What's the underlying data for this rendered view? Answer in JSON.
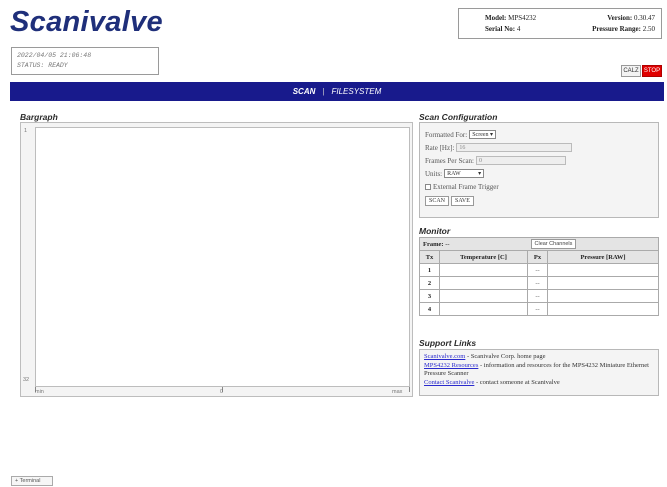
{
  "header": {
    "logo": "Scanivalve",
    "datetime": "2022/04/05 21:06:48",
    "status": "STATUS: READY",
    "model_label": "Model:",
    "model_value": "MPS4232",
    "serial_label": "Serial No:",
    "serial_value": "4",
    "version_label": "Version:",
    "version_value": "0.30.47",
    "range_label": "Pressure Range:",
    "range_value": "2.50",
    "calz_label": "CALZ",
    "stop_label": "STOP"
  },
  "nav": {
    "scan": "SCAN",
    "separator": "|",
    "filesystem": "FILESYSTEM"
  },
  "bargraph": {
    "title": "Bargraph",
    "top_index": "1",
    "bottom_index": "32",
    "x_min": "min",
    "x_mid": "0",
    "x_max": "max"
  },
  "scan_config": {
    "title": "Scan Configuration",
    "formatted_for_label": "Formatted For:",
    "formatted_for_value": "Screen",
    "rate_label": "Rate [Hz]:",
    "rate_value": "16",
    "frames_label": "Frames Per Scan:",
    "frames_value": "0",
    "units_label": "Units:",
    "units_value": "RAW",
    "ext_trigger_label": "External Frame Trigger",
    "scan_button": "SCAN",
    "save_button": "SAVE"
  },
  "monitor": {
    "title": "Monitor",
    "frame_label": "Frame:",
    "frame_value": "--",
    "clear_button": "Clear Channels",
    "headers": [
      "Tx",
      "Temperature [C]",
      "Px",
      "Pressure [RAW]"
    ],
    "rows": [
      {
        "tx": "1",
        "temp": "",
        "px": "--",
        "pressure": ""
      },
      {
        "tx": "2",
        "temp": "",
        "px": "--",
        "pressure": ""
      },
      {
        "tx": "3",
        "temp": "",
        "px": "--",
        "pressure": ""
      },
      {
        "tx": "4",
        "temp": "",
        "px": "--",
        "pressure": ""
      }
    ]
  },
  "support": {
    "title": "Support Links",
    "link1": "Scanivalve.com",
    "link1_desc": " - Scanivalve Corp. home page",
    "link2": "MPS4232 Resources",
    "link2_desc": " - information and resources for the MPS4232 Miniature Ethernet Pressure Scanner",
    "link3": "Contact Scanivalve",
    "link3_desc": " - contact someone at Scanivalve"
  },
  "footer": {
    "terminal_button": "+ Terminal"
  }
}
